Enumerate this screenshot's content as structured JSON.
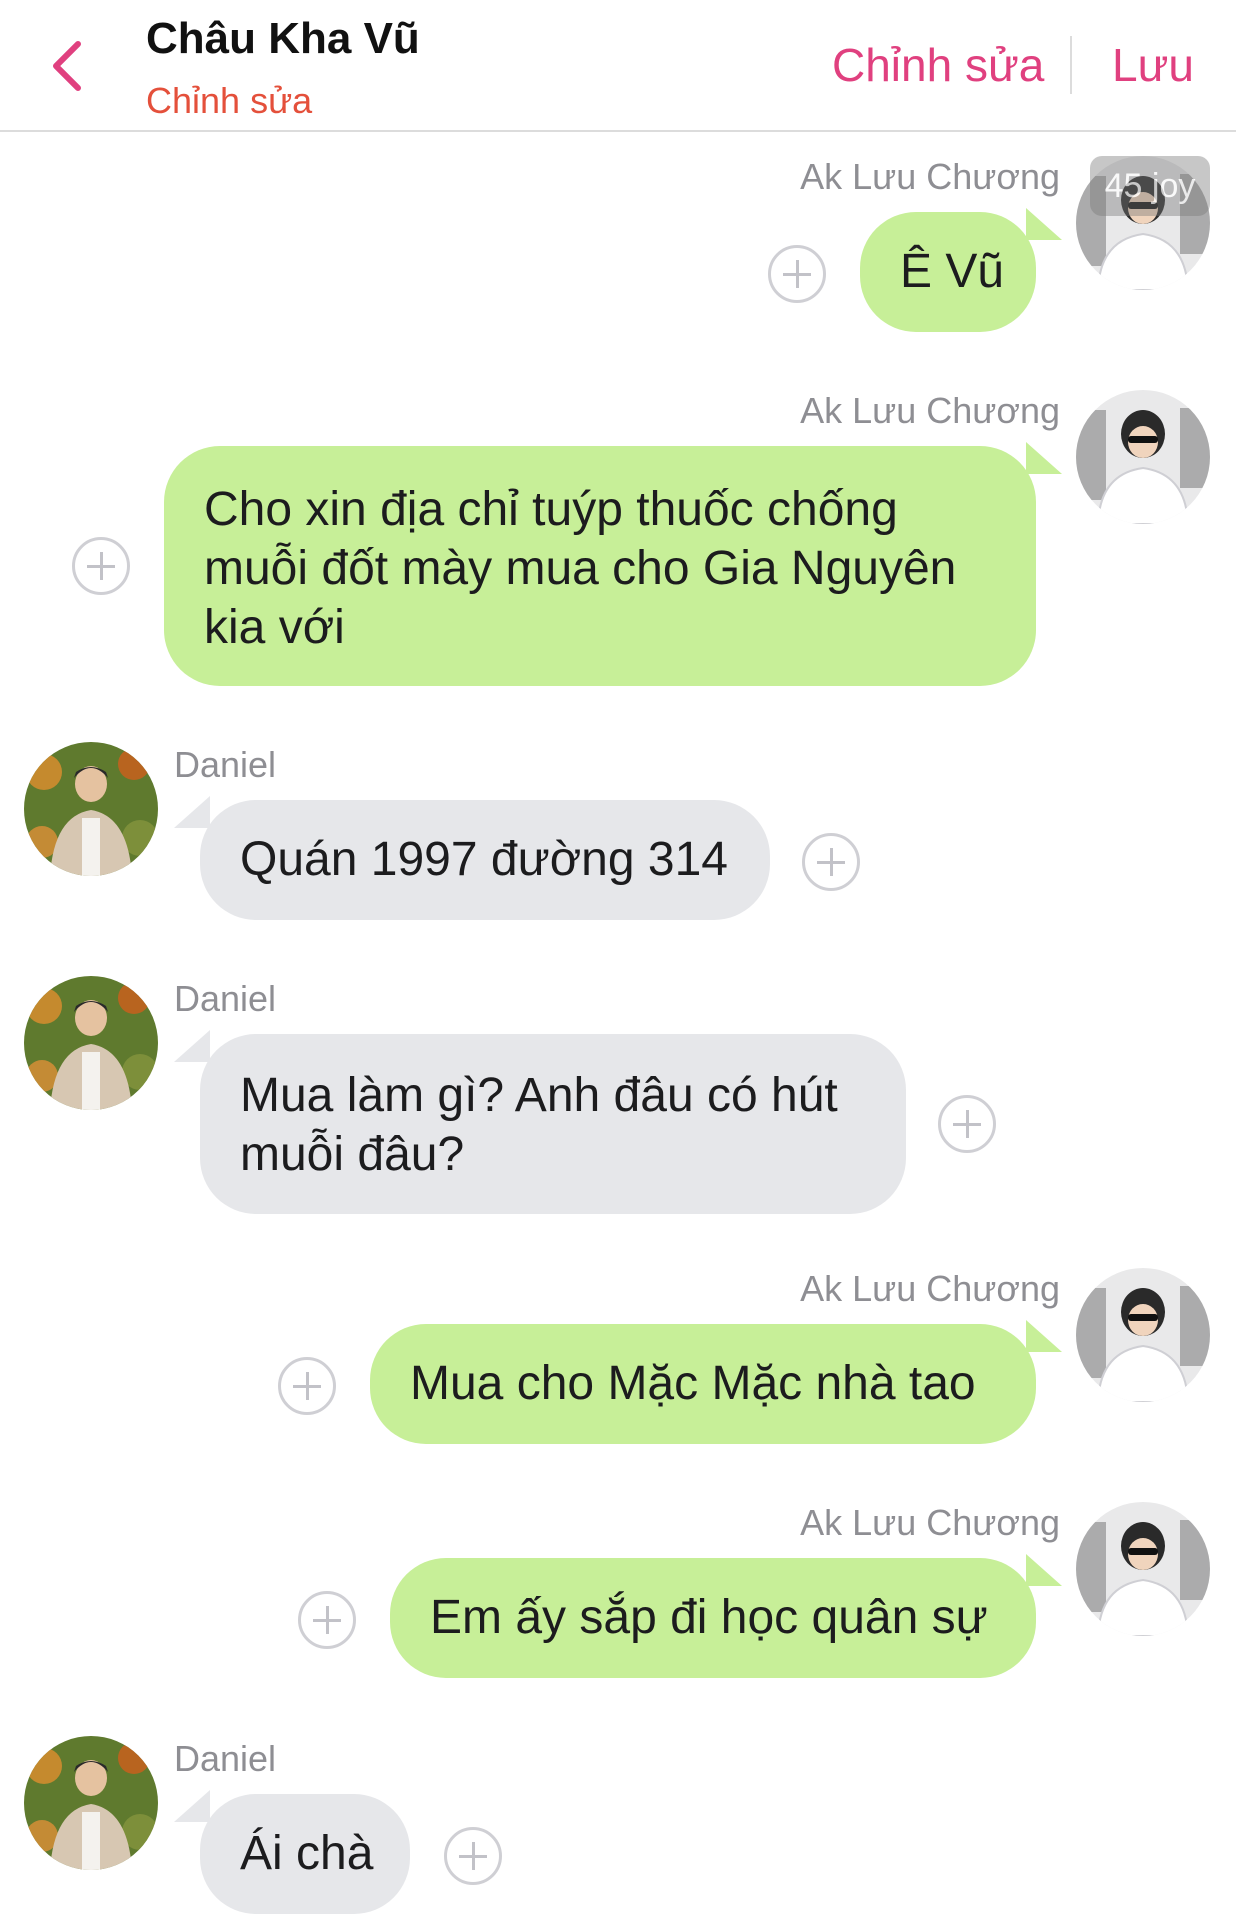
{
  "header": {
    "title": "Châu Kha Vũ",
    "subtitle": "Chỉnh sửa",
    "edit_label": "Chỉnh sửa",
    "save_label": "Lưu"
  },
  "badge": "45 joy",
  "messages": [
    {
      "sender": "Ak Lưu Chương",
      "text": "Ê Vũ",
      "direction": "outgoing"
    },
    {
      "sender": "Ak Lưu Chương",
      "text": "Cho xin địa chỉ tuýp thuốc chống muỗi đốt mày mua cho Gia Nguyên kia với",
      "direction": "outgoing"
    },
    {
      "sender": "Daniel",
      "text": "Quán 1997 đường 314",
      "direction": "incoming"
    },
    {
      "sender": "Daniel",
      "text": "Mua làm gì? Anh đâu có hút muỗi đâu?",
      "direction": "incoming"
    },
    {
      "sender": "Ak Lưu Chương",
      "text": "Mua cho Mặc Mặc nhà tao",
      "direction": "outgoing"
    },
    {
      "sender": "Ak Lưu Chương",
      "text": "Em ấy sắp đi học quân sự",
      "direction": "outgoing"
    },
    {
      "sender": "Daniel",
      "text": "Ái chà",
      "direction": "incoming"
    }
  ],
  "colors": {
    "accent": "#e0407f",
    "subtitle": "#e4503b",
    "outgoing_bubble": "#c7ef98",
    "incoming_bubble": "#e6e7ea",
    "sender_name": "#8e8e93"
  }
}
